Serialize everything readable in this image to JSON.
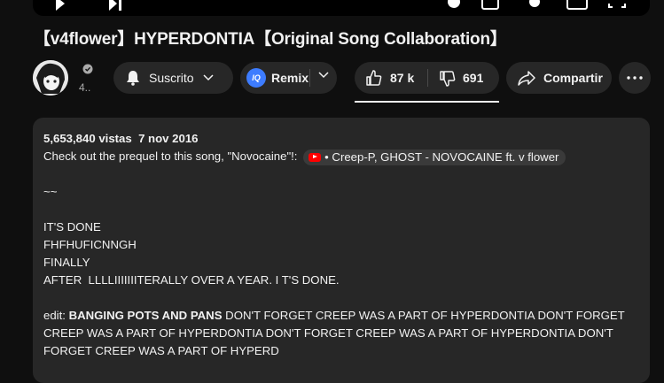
{
  "video": {
    "title": "【v4flower】HYPERDONTIA【Original Song Collaboration】"
  },
  "channel": {
    "subscriber_count_truncated": "4..",
    "verified": true
  },
  "actions": {
    "subscribe_label": "Suscrito",
    "remix_label": "Remix",
    "remix_logo_text": "IQ",
    "likes": "87 k",
    "dislikes": "691",
    "share_label": "Compartir"
  },
  "description": {
    "views": "5,653,840 vistas",
    "date": "7 nov 2016",
    "prequel_text": "Check out the prequel to this song, \"Novocaine\"!:",
    "chip_text": "• Creep-P, GHOST - NOVOCAINE ft. v flower",
    "separator": "~~",
    "lines": [
      "IT'S DONE",
      "FHFHUFICNNGH",
      "FINALLY",
      "AFTER  LLLLIIIIIIITERALLY OVER A YEAR. I T'S DONE."
    ],
    "edit_prefix": "edit: ",
    "edit_bold": "BANGING POTS AND PANS",
    "edit_line1": " DON'T FORGET CREEP WAS A PART OF HYPERDONTIA DON'T FORGET",
    "edit_line2": "CREEP WAS A PART OF HYPERDONTIA DON'T FORGET CREEP WAS A PART OF HYPERDONTIA DON'T",
    "edit_line3": "FORGET CREEP WAS A PART OF HYPERD"
  },
  "colors": {
    "background": "#0f0f0f",
    "pill": "#272727",
    "text": "#f1f1f1",
    "youtube_red": "#ff0000",
    "remix_blue": "#3d7cff"
  }
}
